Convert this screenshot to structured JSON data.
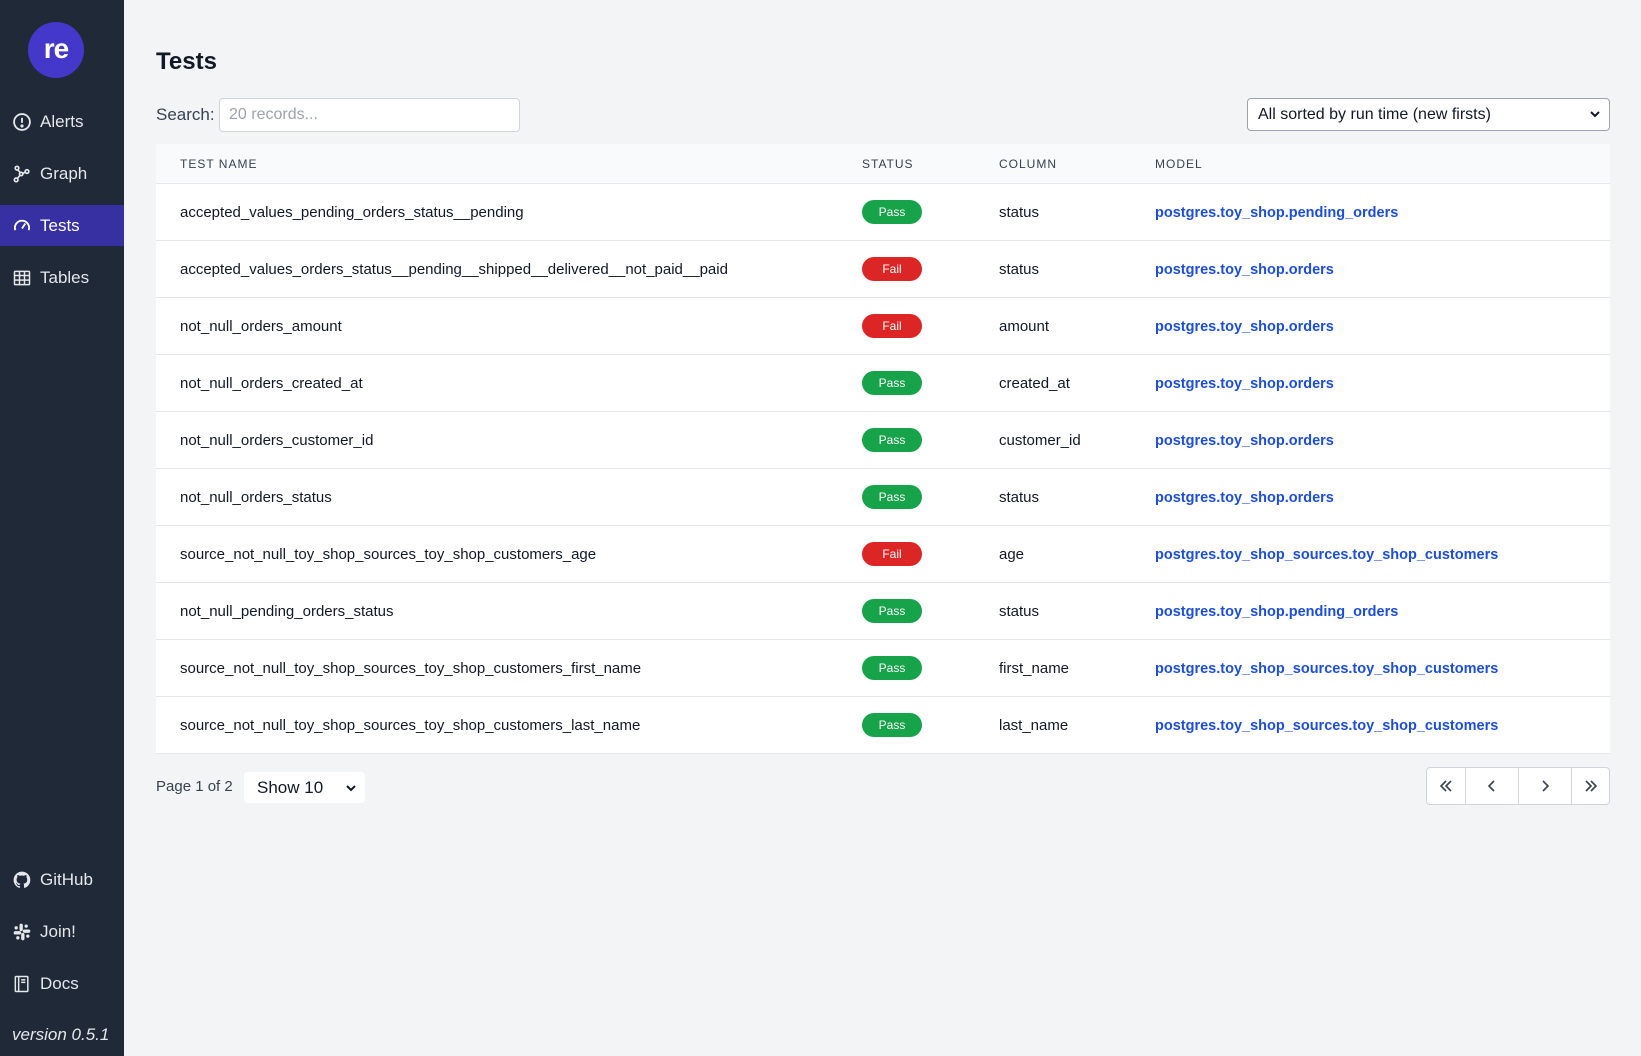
{
  "sidebar": {
    "logo": "re",
    "nav": [
      {
        "label": "Alerts",
        "icon": "alert-circle-icon"
      },
      {
        "label": "Graph",
        "icon": "graph-icon"
      },
      {
        "label": "Tests",
        "icon": "gauge-icon",
        "active": true
      },
      {
        "label": "Tables",
        "icon": "table-icon"
      }
    ],
    "bottom": [
      {
        "label": "GitHub",
        "icon": "github-icon"
      },
      {
        "label": "Join!",
        "icon": "slack-icon"
      },
      {
        "label": "Docs",
        "icon": "book-icon"
      }
    ],
    "version": "version 0.5.1"
  },
  "main": {
    "title": "Tests",
    "search_label": "Search:",
    "search_placeholder": "20 records...",
    "sort_value": "All sorted by run time (new firsts)",
    "columns": [
      "TEST NAME",
      "STATUS",
      "COLUMN",
      "MODEL"
    ],
    "rows": [
      {
        "name": "accepted_values_pending_orders_status__pending",
        "status": "Pass",
        "column": "status",
        "model": "postgres.toy_shop.pending_orders"
      },
      {
        "name": "accepted_values_orders_status__pending__shipped__delivered__not_paid__paid",
        "status": "Fail",
        "column": "status",
        "model": "postgres.toy_shop.orders"
      },
      {
        "name": "not_null_orders_amount",
        "status": "Fail",
        "column": "amount",
        "model": "postgres.toy_shop.orders"
      },
      {
        "name": "not_null_orders_created_at",
        "status": "Pass",
        "column": "created_at",
        "model": "postgres.toy_shop.orders"
      },
      {
        "name": "not_null_orders_customer_id",
        "status": "Pass",
        "column": "customer_id",
        "model": "postgres.toy_shop.orders"
      },
      {
        "name": "not_null_orders_status",
        "status": "Pass",
        "column": "status",
        "model": "postgres.toy_shop.orders"
      },
      {
        "name": "source_not_null_toy_shop_sources_toy_shop_customers_age",
        "status": "Fail",
        "column": "age",
        "model": "postgres.toy_shop_sources.toy_shop_customers"
      },
      {
        "name": "not_null_pending_orders_status",
        "status": "Pass",
        "column": "status",
        "model": "postgres.toy_shop.pending_orders"
      },
      {
        "name": "source_not_null_toy_shop_sources_toy_shop_customers_first_name",
        "status": "Pass",
        "column": "first_name",
        "model": "postgres.toy_shop_sources.toy_shop_customers"
      },
      {
        "name": "source_not_null_toy_shop_sources_toy_shop_customers_last_name",
        "status": "Pass",
        "column": "last_name",
        "model": "postgres.toy_shop_sources.toy_shop_customers"
      }
    ],
    "page_info": "Page 1 of 2",
    "page_size": "Show 10"
  },
  "colors": {
    "sidebar_bg": "#1f2937",
    "active_nav": "#3730a3",
    "logo_bg": "#4338ca",
    "pass": "#16a34a",
    "fail": "#dc2626",
    "link": "#1d4ed8"
  }
}
